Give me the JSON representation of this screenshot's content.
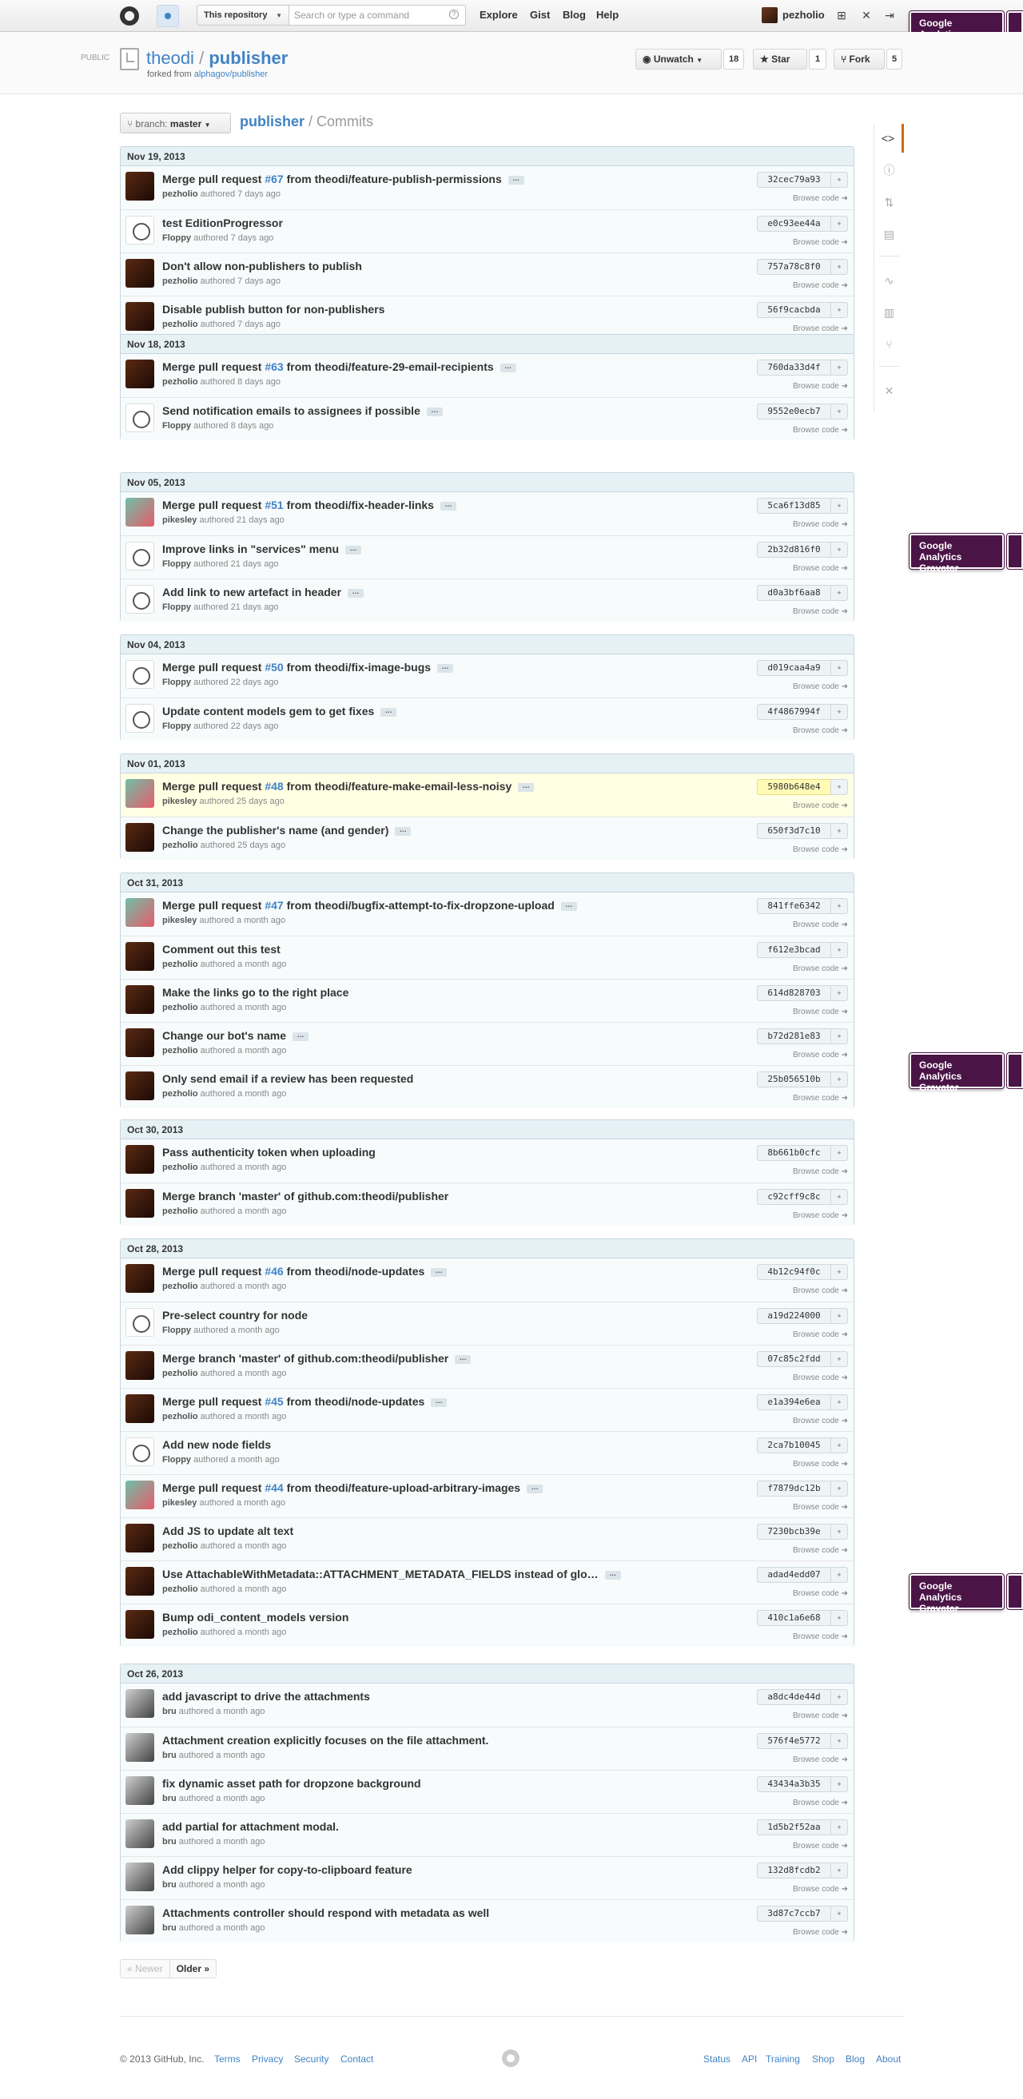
{
  "header": {
    "scope": "This repository",
    "search_placeholder": "Search or type a command",
    "nav": [
      "Explore",
      "Gist",
      "Blog",
      "Help"
    ],
    "username": "pezholio"
  },
  "overlay": {
    "line1": "Google Analytics",
    "line2": "Gravatar"
  },
  "repo": {
    "visibility": "PUBLIC",
    "owner": "theodi",
    "separator": "/",
    "name": "publisher",
    "forked_prefix": "forked from",
    "forked_from": "alphagov/publisher",
    "unwatch_label": "Unwatch",
    "unwatch_count": "18",
    "star_label": "Star",
    "star_count": "1",
    "fork_label": "Fork",
    "fork_count": "5"
  },
  "branch": {
    "prefix": "branch:",
    "name": "master"
  },
  "breadcrumb": {
    "repo": "publisher",
    "section": "Commits"
  },
  "browse_label": "Browse code",
  "days": [
    {
      "date": "Nov 19, 2013",
      "commits": [
        {
          "prefix": "Merge pull request ",
          "pr": "#67",
          "suffix": " from theodi/feature-publish-permissions",
          "ellipsis": true,
          "author": "pezholio",
          "when": "authored 7 days ago",
          "sha": "32cec79a93",
          "avatar": "dark"
        },
        {
          "prefix": "test EditionProgressor",
          "author": "Floppy",
          "when": "authored 7 days ago",
          "sha": "e0c93ee44a",
          "avatar": "floppy"
        },
        {
          "prefix": "Don't allow non-publishers to publish",
          "author": "pezholio",
          "when": "authored 7 days ago",
          "sha": "757a78c8f0",
          "avatar": "dark"
        },
        {
          "prefix": "Disable publish button for non-publishers",
          "author": "pezholio",
          "when": "authored 7 days ago",
          "sha": "56f9cacbda",
          "avatar": "dark"
        }
      ]
    },
    {
      "date": "Nov 18, 2013",
      "commits": [
        {
          "prefix": "Merge pull request ",
          "pr": "#63",
          "suffix": " from theodi/feature-29-email-recipients",
          "ellipsis": true,
          "author": "pezholio",
          "when": "authored 8 days ago",
          "sha": "760da33d4f",
          "avatar": "dark"
        },
        {
          "prefix": "Send notification emails to assignees if possible",
          "ellipsis": true,
          "author": "Floppy",
          "when": "authored 8 days ago",
          "sha": "9552e0ecb7",
          "avatar": "floppy"
        }
      ]
    },
    {
      "date": "Nov 05, 2013",
      "commits": [
        {
          "prefix": "Merge pull request ",
          "pr": "#51",
          "suffix": " from theodi/fix-header-links",
          "ellipsis": true,
          "author": "pikesley",
          "when": "authored 21 days ago",
          "sha": "5ca6f13d85",
          "avatar": "pike"
        },
        {
          "prefix": "Improve links in \"services\" menu",
          "ellipsis": true,
          "author": "Floppy",
          "when": "authored 21 days ago",
          "sha": "2b32d816f0",
          "avatar": "floppy"
        },
        {
          "prefix": "Add link to new artefact in header",
          "ellipsis": true,
          "author": "Floppy",
          "when": "authored 21 days ago",
          "sha": "d0a3bf6aa8",
          "avatar": "floppy"
        }
      ]
    },
    {
      "date": "Nov 04, 2013",
      "commits": [
        {
          "prefix": "Merge pull request ",
          "pr": "#50",
          "suffix": " from theodi/fix-image-bugs",
          "ellipsis": true,
          "author": "Floppy",
          "when": "authored 22 days ago",
          "sha": "d019caa4a9",
          "avatar": "floppy"
        },
        {
          "prefix": "Update content models gem to get fixes",
          "ellipsis": true,
          "author": "Floppy",
          "when": "authored 22 days ago",
          "sha": "4f4867994f",
          "avatar": "floppy"
        }
      ]
    },
    {
      "date": "Nov 01, 2013",
      "commits": [
        {
          "prefix": "Merge pull request ",
          "pr": "#48",
          "suffix": " from theodi/feature-make-email-less-noisy",
          "ellipsis": true,
          "author": "pikesley",
          "when": "authored 25 days ago",
          "sha": "5980b648e4",
          "avatar": "pike",
          "highlight": true
        },
        {
          "prefix": "Change the publisher's name (and gender)",
          "ellipsis": true,
          "author": "pezholio",
          "when": "authored 25 days ago",
          "sha": "650f3d7c10",
          "avatar": "dark"
        }
      ]
    },
    {
      "date": "Oct 31, 2013",
      "commits": [
        {
          "prefix": "Merge pull request ",
          "pr": "#47",
          "suffix": " from theodi/bugfix-attempt-to-fix-dropzone-upload",
          "ellipsis": true,
          "author": "pikesley",
          "when": "authored a month ago",
          "sha": "841ffe6342",
          "avatar": "pike"
        },
        {
          "prefix": "Comment out this test",
          "author": "pezholio",
          "when": "authored a month ago",
          "sha": "f612e3bcad",
          "avatar": "dark"
        },
        {
          "prefix": "Make the links go to the right place",
          "author": "pezholio",
          "when": "authored a month ago",
          "sha": "614d828703",
          "avatar": "dark"
        },
        {
          "prefix": "Change our bot's name",
          "ellipsis": true,
          "author": "pezholio",
          "when": "authored a month ago",
          "sha": "b72d281e83",
          "avatar": "dark"
        },
        {
          "prefix": "Only send email if a review has been requested",
          "author": "pezholio",
          "when": "authored a month ago",
          "sha": "25b056510b",
          "avatar": "dark"
        }
      ]
    },
    {
      "date": "Oct 30, 2013",
      "commits": [
        {
          "prefix": "Pass authenticity token when uploading",
          "author": "pezholio",
          "when": "authored a month ago",
          "sha": "8b661b0cfc",
          "avatar": "dark"
        },
        {
          "prefix": "Merge branch 'master' of github.com:theodi/publisher",
          "author": "pezholio",
          "when": "authored a month ago",
          "sha": "c92cff9c8c",
          "avatar": "dark"
        }
      ]
    },
    {
      "date": "Oct 28, 2013",
      "commits": [
        {
          "prefix": "Merge pull request ",
          "pr": "#46",
          "suffix": " from theodi/node-updates",
          "ellipsis": true,
          "author": "pezholio",
          "when": "authored a month ago",
          "sha": "4b12c94f0c",
          "avatar": "dark"
        },
        {
          "prefix": "Pre-select country for node",
          "author": "Floppy",
          "when": "authored a month ago",
          "sha": "a19d224000",
          "avatar": "floppy"
        },
        {
          "prefix": "Merge branch 'master' of github.com:theodi/publisher",
          "ellipsis": true,
          "author": "pezholio",
          "when": "authored a month ago",
          "sha": "07c85c2fdd",
          "avatar": "dark"
        },
        {
          "prefix": "Merge pull request ",
          "pr": "#45",
          "suffix": " from theodi/node-updates",
          "ellipsis": true,
          "author": "pezholio",
          "when": "authored a month ago",
          "sha": "e1a394e6ea",
          "avatar": "dark"
        },
        {
          "prefix": "Add new node fields",
          "author": "Floppy",
          "when": "authored a month ago",
          "sha": "2ca7b10045",
          "avatar": "floppy"
        },
        {
          "prefix": "Merge pull request ",
          "pr": "#44",
          "suffix": " from theodi/feature-upload-arbitrary-images",
          "ellipsis": true,
          "author": "pikesley",
          "when": "authored a month ago",
          "sha": "f7879dc12b",
          "avatar": "pike"
        },
        {
          "prefix": "Add JS to update alt text",
          "author": "pezholio",
          "when": "authored a month ago",
          "sha": "7230bcb39e",
          "avatar": "dark"
        },
        {
          "prefix": "Use AttachableWithMetadata::ATTACHMENT_METADATA_FIELDS instead of glo…",
          "ellipsis": true,
          "author": "pezholio",
          "when": "authored a month ago",
          "sha": "adad4edd07",
          "avatar": "dark"
        },
        {
          "prefix": "Bump odi_content_models version",
          "author": "pezholio",
          "when": "authored a month ago",
          "sha": "410c1a6e68",
          "avatar": "dark"
        }
      ]
    },
    {
      "date": "Oct 26, 2013",
      "commits": [
        {
          "prefix": "add javascript to drive the attachments",
          "author": "bru",
          "when": "authored a month ago",
          "sha": "a8dc4de44d",
          "avatar": "bru"
        },
        {
          "prefix": "Attachment creation explicitly focuses on the file attachment.",
          "author": "bru",
          "when": "authored a month ago",
          "sha": "576f4e5772",
          "avatar": "bru"
        },
        {
          "prefix": "fix dynamic asset path for dropzone background",
          "author": "bru",
          "when": "authored a month ago",
          "sha": "43434a3b35",
          "avatar": "bru"
        },
        {
          "prefix": "add partial for attachment modal.",
          "author": "bru",
          "when": "authored a month ago",
          "sha": "1d5b2f52aa",
          "avatar": "bru"
        },
        {
          "prefix": "Add clippy helper for copy-to-clipboard feature",
          "author": "bru",
          "when": "authored a month ago",
          "sha": "132d8fcdb2",
          "avatar": "bru"
        },
        {
          "prefix": "Attachments controller should respond with metadata as well",
          "author": "bru",
          "when": "authored a month ago",
          "sha": "3d87c7ccb7",
          "avatar": "bru"
        }
      ]
    }
  ],
  "pager": {
    "newer": "« Newer",
    "older": "Older »"
  },
  "footer": {
    "copyright": "© 2013 GitHub, Inc.",
    "left_links": [
      "Terms",
      "Privacy",
      "Security",
      "Contact"
    ],
    "right_links": [
      "Status",
      "API",
      "Training",
      "Shop",
      "Blog",
      "About"
    ]
  }
}
